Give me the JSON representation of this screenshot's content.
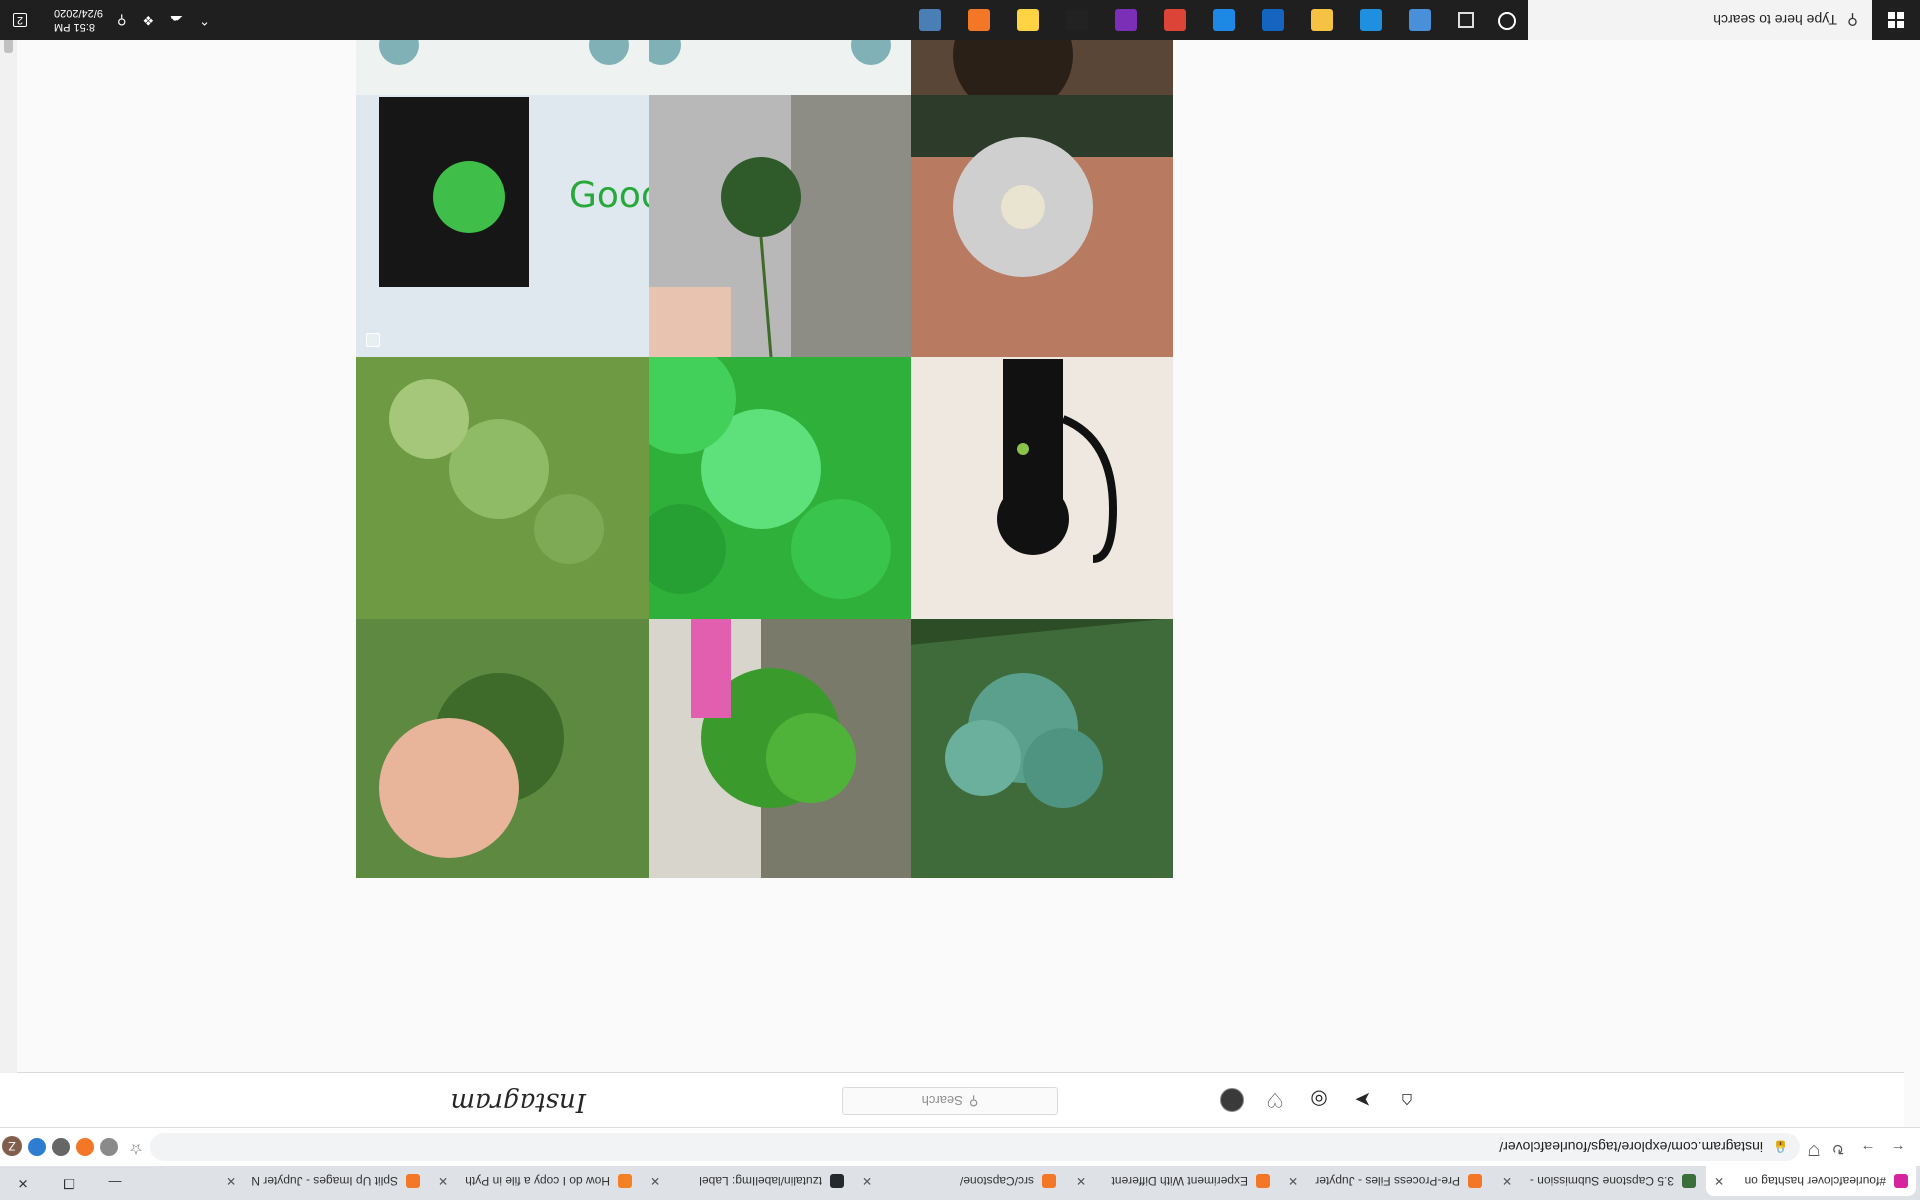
{
  "taskbar": {
    "search_placeholder": "Type here to search",
    "apps": [
      {
        "icon": "task-manager-icon",
        "color": "#4a90d9"
      },
      {
        "icon": "microsoft-edge-icon",
        "color": "#1f8fe0"
      },
      {
        "icon": "sticky-notes-icon",
        "color": "#f6c244"
      },
      {
        "icon": "photoshop-icon",
        "color": "#1565c0"
      },
      {
        "icon": "mail-icon",
        "color": "#1e88e5"
      },
      {
        "icon": "chrome-icon",
        "color": "#db4437"
      },
      {
        "icon": "onenote-icon",
        "color": "#7b2fb6"
      },
      {
        "icon": "terminal-icon",
        "color": "#222222"
      },
      {
        "icon": "python-icon",
        "color": "#ffd343"
      },
      {
        "icon": "jupyter-icon",
        "color": "#f37726"
      },
      {
        "icon": "file-explorer-icon",
        "color": "#4a7fb5"
      }
    ],
    "time": "8:51 PM",
    "date": "9/24/2020",
    "notification_count": "2"
  },
  "browser": {
    "tabs": [
      {
        "title": "#fourleafclover hashtag on",
        "icon": "instagram-icon",
        "color": "#d6249f",
        "active": true
      },
      {
        "title": "3.5 Capstone Submission -",
        "icon": "springboard-icon",
        "color": "#3a6e3a",
        "active": false
      },
      {
        "title": "Pre-Process Files - Jupyter",
        "icon": "jupyter-icon",
        "color": "#f37726",
        "active": false
      },
      {
        "title": "Experiment With Different",
        "icon": "jupyter-icon",
        "color": "#f37726",
        "active": false
      },
      {
        "title": "src/Capstone/",
        "icon": "jupyter-icon",
        "color": "#f37726",
        "active": false
      },
      {
        "title": "tzutalin/labelImg: Label",
        "icon": "github-icon",
        "color": "#24292e",
        "active": false
      },
      {
        "title": "How do I copy a file in Pyth",
        "icon": "stackoverflow-icon",
        "color": "#f48024",
        "active": false
      },
      {
        "title": "Split Up Images - Jupyter N",
        "icon": "jupyter-icon",
        "color": "#f37726",
        "active": false
      }
    ],
    "url": "instagram.com/explore/tags/fourleafclover/"
  },
  "instagram": {
    "logo": "Instagram",
    "search_placeholder": "Search",
    "nav_icons": [
      "home-icon",
      "direct-icon",
      "explore-icon",
      "activity-icon",
      "profile-avatar"
    ]
  },
  "posts": [
    {
      "name": "post-clover-grass-dark",
      "multi": false
    },
    {
      "name": "post-clover-pink-leash",
      "multi": false
    },
    {
      "name": "post-clover-held-fingers",
      "multi": false
    },
    {
      "name": "post-cat-drawing",
      "multi": true
    },
    {
      "name": "post-bright-clover-patch",
      "multi": false
    },
    {
      "name": "post-clover-in-grass",
      "multi": false
    },
    {
      "name": "post-diamond-brooch",
      "multi": false
    },
    {
      "name": "post-clover-held-sky",
      "multi": false
    },
    {
      "name": "post-good-luck-card",
      "multi": true
    },
    {
      "name": "post-dog-partial",
      "multi": true
    },
    {
      "name": "post-good-day-banner-2",
      "multi": true
    },
    {
      "name": "post-good-day-banner-1",
      "multi": false
    }
  ]
}
